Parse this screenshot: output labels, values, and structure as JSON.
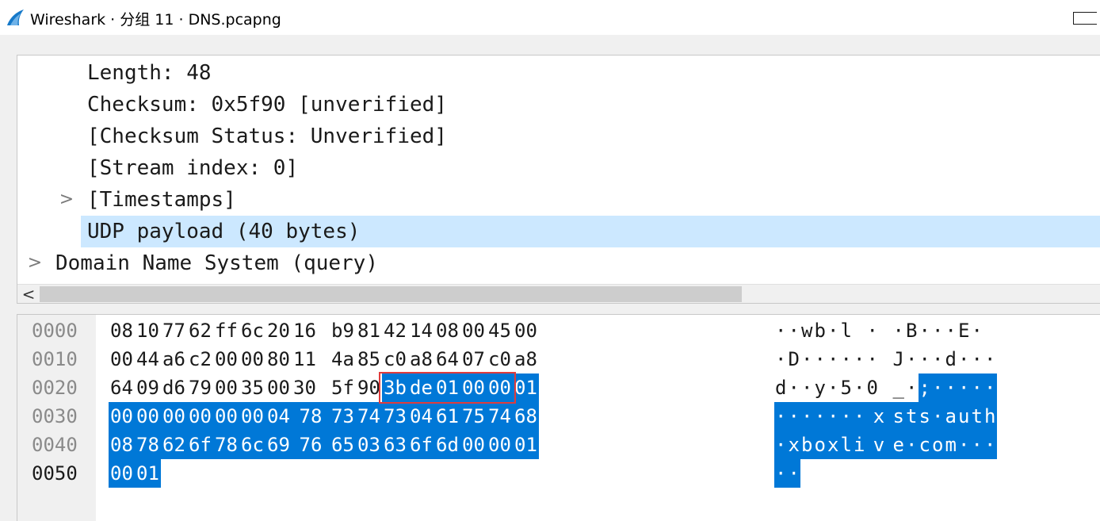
{
  "window": {
    "title": "Wireshark · 分组 11 · DNS.pcapng"
  },
  "details": {
    "rows": [
      {
        "text": "Length: 48",
        "expandable": false,
        "selected": false
      },
      {
        "text": "Checksum: 0x5f90 [unverified]",
        "expandable": false,
        "selected": false
      },
      {
        "text": "[Checksum Status: Unverified]",
        "expandable": false,
        "selected": false
      },
      {
        "text": "[Stream index: 0]",
        "expandable": false,
        "selected": false
      },
      {
        "text": "[Timestamps]",
        "expandable": true,
        "selected": false
      },
      {
        "text": "UDP payload (40 bytes)",
        "expandable": false,
        "selected": true
      },
      {
        "text": "Domain Name System (query)",
        "expandable": true,
        "selected": false
      }
    ],
    "expander_glyph": ">",
    "scroll_left_glyph": "<"
  },
  "bytes": {
    "rows": [
      {
        "offset": "0000",
        "hex": [
          "08",
          "10",
          "77",
          "62",
          "ff",
          "6c",
          "20",
          "16",
          "b9",
          "81",
          "42",
          "14",
          "08",
          "00",
          "45",
          "00"
        ],
        "ascii": "··wb·l ··B···E·"
      },
      {
        "offset": "0010",
        "hex": [
          "00",
          "44",
          "a6",
          "c2",
          "00",
          "00",
          "80",
          "11",
          "4a",
          "85",
          "c0",
          "a8",
          "64",
          "07",
          "c0",
          "a8"
        ],
        "ascii": "·D······J···d···"
      },
      {
        "offset": "0020",
        "hex": [
          "64",
          "09",
          "d6",
          "79",
          "00",
          "35",
          "00",
          "30",
          "5f",
          "90",
          "3b",
          "de",
          "01",
          "00",
          "00",
          "01"
        ],
        "ascii": "d··y·5·0_·;·····"
      },
      {
        "offset": "0030",
        "hex": [
          "00",
          "00",
          "00",
          "00",
          "00",
          "00",
          "04",
          "78",
          "73",
          "74",
          "73",
          "04",
          "61",
          "75",
          "74",
          "68"
        ],
        "ascii": "·······xsts·auth"
      },
      {
        "offset": "0040",
        "hex": [
          "08",
          "78",
          "62",
          "6f",
          "78",
          "6c",
          "69",
          "76",
          "65",
          "03",
          "63",
          "6f",
          "6d",
          "00",
          "00",
          "01"
        ],
        "ascii": "·xboxlive·com···"
      },
      {
        "offset": "0050",
        "hex": [
          "00",
          "01"
        ],
        "ascii": "··"
      }
    ],
    "selected_range_start": 42,
    "selected_range_length": 40,
    "highlighted_box_start": 42,
    "highlighted_box_length": 5
  },
  "colors": {
    "selection": "#0078d7",
    "tree_selection": "#cce8ff",
    "highlight_box": "#e03c3c"
  }
}
